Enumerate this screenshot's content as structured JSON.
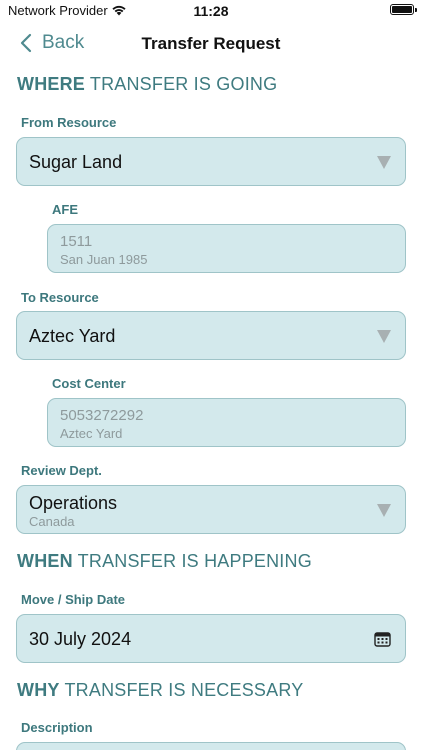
{
  "status_bar": {
    "carrier": "Network Provider",
    "time": "11:28",
    "wifi_icon": "wifi-icon",
    "battery_icon": "battery-icon"
  },
  "nav": {
    "back_label": "Back",
    "title": "Transfer Request"
  },
  "sections": {
    "where": {
      "bold": "WHERE",
      "rest": " TRANSFER IS GOING"
    },
    "when": {
      "bold": "WHEN",
      "rest": " TRANSFER IS HAPPENING"
    },
    "why": {
      "bold": "WHY",
      "rest": " TRANSFER IS NECESSARY"
    }
  },
  "form": {
    "from_resource": {
      "label": "From Resource",
      "value": "Sugar Land"
    },
    "afe": {
      "label": "AFE",
      "value": "1511",
      "subvalue": "San Juan 1985"
    },
    "to_resource": {
      "label": "To Resource",
      "value": "Aztec Yard"
    },
    "cost_center": {
      "label": "Cost Center",
      "value": "5053272292",
      "subvalue": "Aztec Yard"
    },
    "review_dept": {
      "label": "Review Dept.",
      "value": "Operations",
      "subvalue": "Canada"
    },
    "move_date": {
      "label": "Move / Ship Date",
      "value": "30 July 2024"
    },
    "description": {
      "label": "Description",
      "value": ""
    }
  },
  "colors": {
    "accent": "#3f7b80",
    "field_bg": "#d3e9ec",
    "field_border": "#9fc4c8"
  }
}
